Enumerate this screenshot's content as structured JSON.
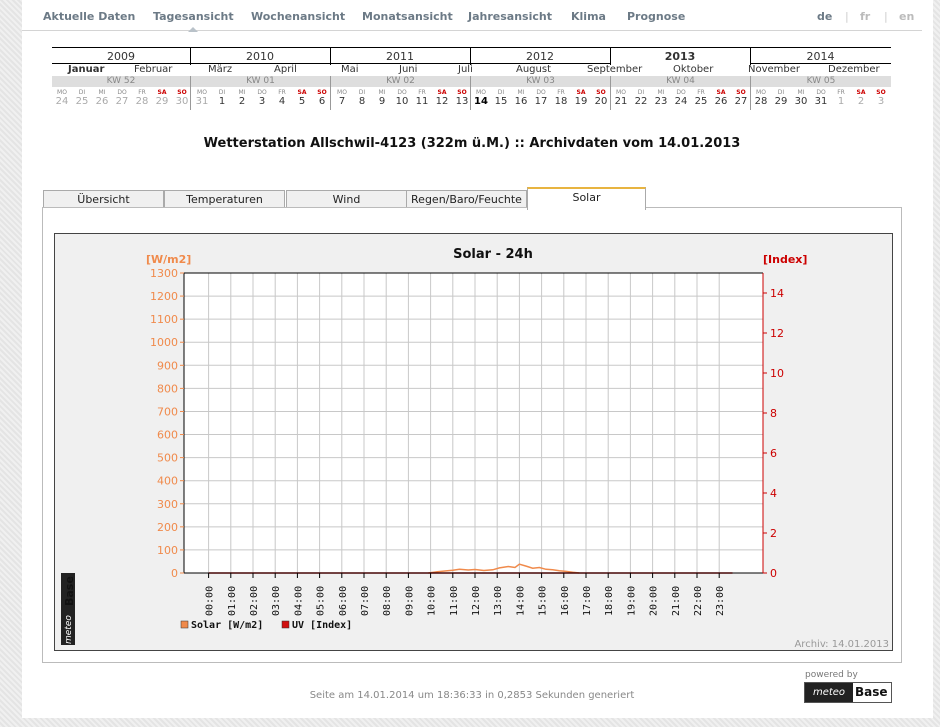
{
  "nav": {
    "items": [
      "Aktuelle Daten",
      "Tagesansicht",
      "Wochenansicht",
      "Monatsansicht",
      "Jahresansicht",
      "Klima",
      "Prognose"
    ],
    "active": "Tagesansicht",
    "languages": [
      "de",
      "fr",
      "en"
    ],
    "active_language": "de"
  },
  "calendar": {
    "years": [
      "2009",
      "2010",
      "2011",
      "2012",
      "2013",
      "2014"
    ],
    "current_year": "2013",
    "months": [
      "Januar",
      "Februar",
      "März",
      "April",
      "Mai",
      "Juni",
      "Juli",
      "August",
      "September",
      "Oktober",
      "November",
      "Dezember"
    ],
    "current_month": "Januar",
    "weeks": [
      "KW 52",
      "KW 01",
      "KW 02",
      "KW 03",
      "KW 04",
      "KW 05"
    ],
    "day_names": [
      "MO",
      "DI",
      "MI",
      "DO",
      "FR",
      "SA",
      "SO"
    ],
    "days": [
      "24",
      "25",
      "26",
      "27",
      "28",
      "29",
      "30",
      "31",
      "1",
      "2",
      "3",
      "4",
      "5",
      "6",
      "7",
      "8",
      "9",
      "10",
      "11",
      "12",
      "13",
      "14",
      "15",
      "16",
      "17",
      "18",
      "19",
      "20",
      "21",
      "22",
      "23",
      "24",
      "25",
      "26",
      "27",
      "28",
      "29",
      "30",
      "31",
      "1",
      "2",
      "3"
    ],
    "selected_day": "14"
  },
  "title": "Wetterstation Allschwil-4123 (322m ü.M.) :: Archivdaten vom 14.01.2013",
  "tabs": [
    "Übersicht",
    "Temperaturen",
    "Wind",
    "Regen/Baro/Feuchte",
    "Solar"
  ],
  "active_tab": "Solar",
  "chart_data": {
    "type": "line",
    "title": "Solar - 24h",
    "ylabel_left": "[W/m2]",
    "ylabel_right": "[Index]",
    "ylim_left": [
      0,
      1300
    ],
    "yticks_left": [
      0,
      100,
      200,
      300,
      400,
      500,
      600,
      700,
      800,
      900,
      1000,
      1100,
      1200,
      1300
    ],
    "ylim_right": [
      0,
      15
    ],
    "yticks_right": [
      0,
      2,
      4,
      6,
      8,
      10,
      12,
      14
    ],
    "categories": [
      "00:00",
      "01:00",
      "02:00",
      "03:00",
      "04:00",
      "05:00",
      "06:00",
      "07:00",
      "08:00",
      "09:00",
      "10:00",
      "11:00",
      "12:00",
      "13:00",
      "14:00",
      "15:00",
      "16:00",
      "17:00",
      "18:00",
      "19:00",
      "20:00",
      "21:00",
      "22:00",
      "23:00"
    ],
    "grid": true,
    "series": [
      {
        "name": "Solar [W/m2]",
        "color": "#f08a4b",
        "axis": "left",
        "x": [
          9.9,
          10.3,
          10.7,
          11.0,
          11.3,
          11.7,
          12.0,
          12.4,
          12.8,
          13.1,
          13.5,
          13.8,
          14.0,
          14.3,
          14.6,
          14.9,
          15.2,
          15.5,
          15.8,
          16.1,
          16.4,
          16.7
        ],
        "y": [
          0,
          5,
          9,
          12,
          16,
          13,
          15,
          11,
          14,
          22,
          28,
          24,
          38,
          30,
          21,
          24,
          16,
          14,
          10,
          7,
          3,
          0
        ]
      },
      {
        "name": "UV [Index]",
        "color": "#d01010",
        "axis": "right",
        "x": [
          0,
          23.6
        ],
        "y": [
          0,
          0
        ]
      }
    ],
    "archive_label": "Archiv: 14.01.2013"
  },
  "footer": {
    "generated": "Seite am 14.01.2014 um 18:36:33 in 0,2853 Sekunden generiert",
    "powered_by": "powered by",
    "logo_left": "meteo",
    "logo_right": "Base"
  },
  "colors": {
    "solar": "#f08a4b",
    "uv": "#d01010",
    "tab_accent": "#e8b440",
    "nav": "#6c7a86"
  }
}
